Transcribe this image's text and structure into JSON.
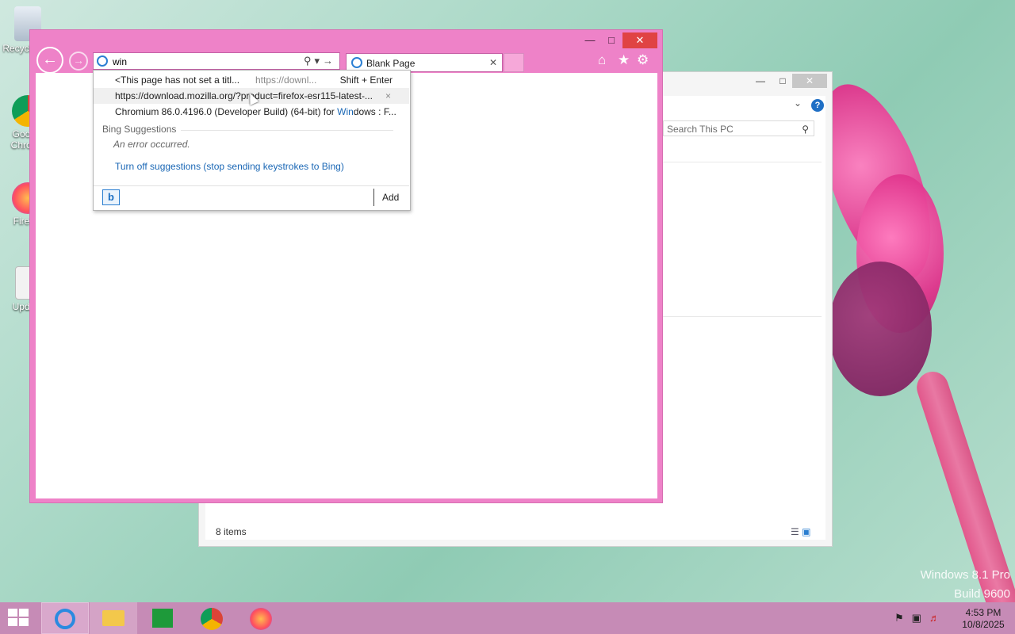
{
  "desktop": {
    "icons": [
      {
        "label": "Recycle Bin"
      },
      {
        "label": "Google Chrome"
      },
      {
        "label": "Firefox"
      },
      {
        "label": "Update"
      }
    ],
    "watermark": {
      "line1": "Windows 8.1 Pro",
      "line2": "Build 9600"
    }
  },
  "explorer": {
    "search_placeholder": "Search This PC",
    "status": "8 items",
    "help": "?"
  },
  "ie": {
    "address_value": "win",
    "tab_label": "Blank Page",
    "dropdown": {
      "rows": [
        {
          "text": "<This page has not set a titl...",
          "sub": "https://downl...",
          "hint": "Shift + Enter"
        },
        {
          "text": "https://download.mozilla.org/?product=firefox-esr115-latest-...",
          "remove": "×"
        },
        {
          "text_pre": "Chromium 86.0.4196.0 (Developer Build) (64-bit) for ",
          "text_hl": "Win",
          "text_post": "dows : F..."
        }
      ],
      "section_heading": "Bing Suggestions",
      "error": "An error occurred.",
      "turn_off_link": "Turn off suggestions (stop sending keystrokes to Bing)",
      "bing_icon": "b",
      "add_label": "Add"
    }
  },
  "taskbar": {
    "clock_time": "4:53 PM",
    "clock_date": "10/8/2025",
    "pinned": [
      "internet-explorer",
      "file-explorer",
      "store",
      "chrome",
      "firefox"
    ]
  },
  "colors": {
    "ie_frame": "#ee82c8",
    "taskbar": "#c68bb6",
    "link": "#1a67b5",
    "close": "#e04343"
  }
}
